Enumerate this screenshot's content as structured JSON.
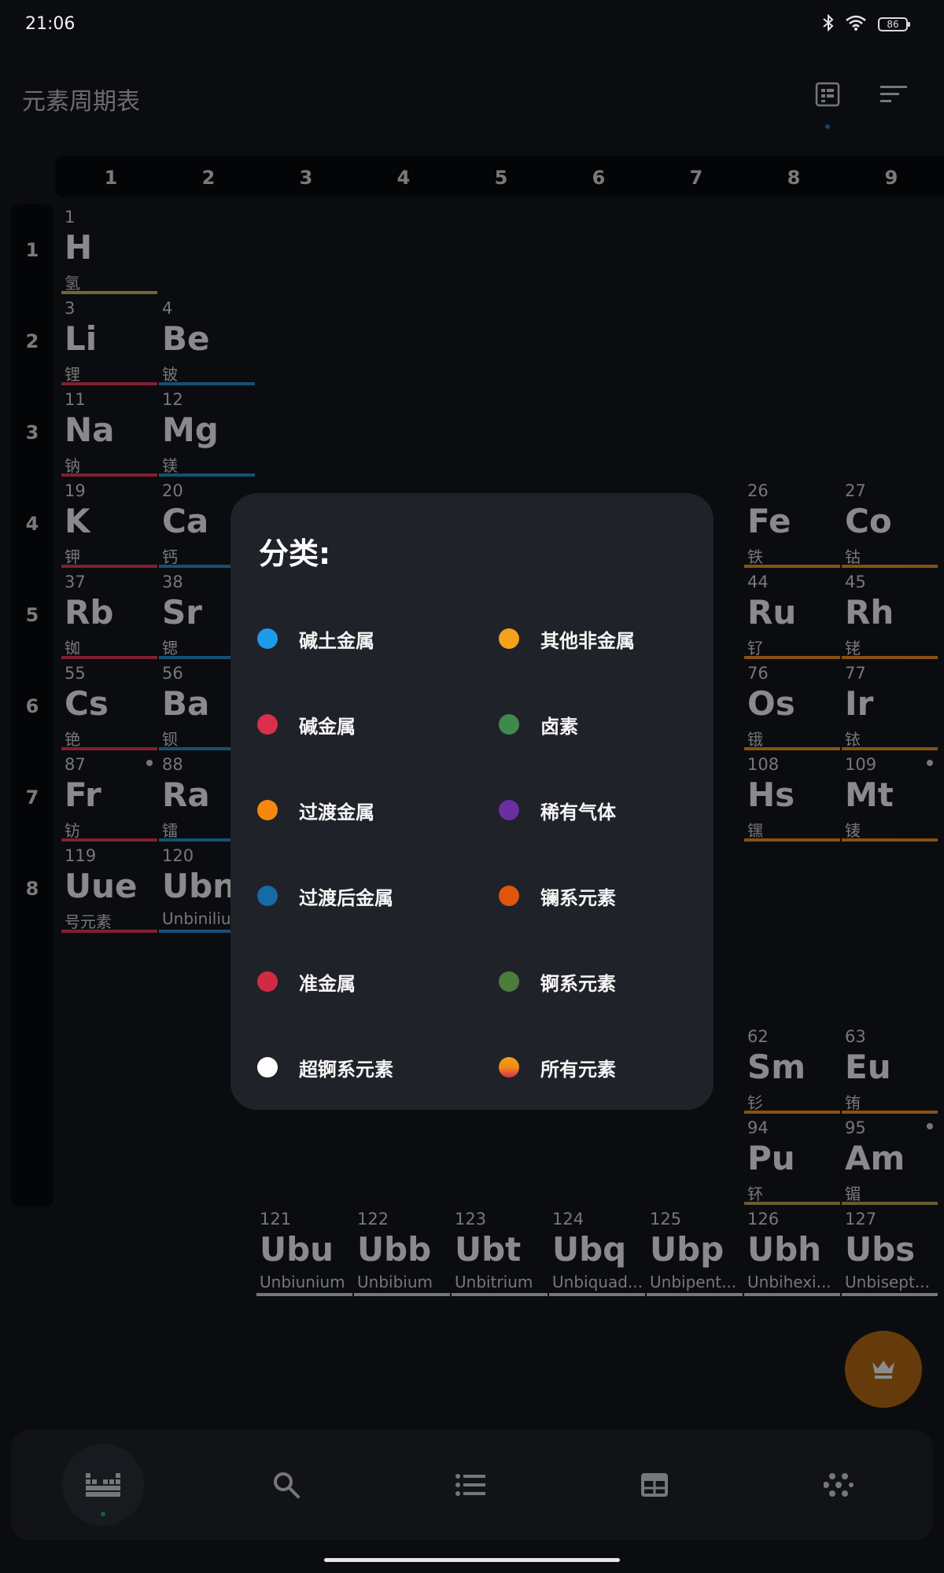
{
  "status_bar": {
    "time": "21:06",
    "battery": "86",
    "icons": [
      "bluetooth-icon",
      "wifi-icon",
      "battery-icon"
    ]
  },
  "app_bar": {
    "title": "元素周期表",
    "actions": [
      "layout-view-icon",
      "sort-icon"
    ]
  },
  "table": {
    "groups": [
      "1",
      "2",
      "3",
      "4",
      "5",
      "6",
      "7",
      "8",
      "9"
    ],
    "periods": [
      "1",
      "2",
      "3",
      "4",
      "5",
      "6",
      "7",
      "8"
    ],
    "cells": [
      {
        "num": "1",
        "sym": "H",
        "name": "氢",
        "cat": "hal"
      },
      {
        "num": "3",
        "sym": "Li",
        "name": "锂",
        "cat": "alk"
      },
      {
        "num": "4",
        "sym": "Be",
        "name": "铍",
        "cat": "ae"
      },
      {
        "num": "11",
        "sym": "Na",
        "name": "钠",
        "cat": "alk"
      },
      {
        "num": "12",
        "sym": "Mg",
        "name": "镁",
        "cat": "ae"
      },
      {
        "num": "19",
        "sym": "K",
        "name": "钾",
        "cat": "alk"
      },
      {
        "num": "20",
        "sym": "Ca",
        "name": "钙",
        "cat": "ae"
      },
      {
        "num": "26",
        "sym": "Fe",
        "name": "铁",
        "cat": "tm"
      },
      {
        "num": "27",
        "sym": "Co",
        "name": "钴",
        "cat": "tm"
      },
      {
        "num": "37",
        "sym": "Rb",
        "name": "铷",
        "cat": "alk"
      },
      {
        "num": "38",
        "sym": "Sr",
        "name": "锶",
        "cat": "ae"
      },
      {
        "num": "44",
        "sym": "Ru",
        "name": "钌",
        "cat": "tm"
      },
      {
        "num": "45",
        "sym": "Rh",
        "name": "铑",
        "cat": "tm"
      },
      {
        "num": "55",
        "sym": "Cs",
        "name": "铯",
        "cat": "alk"
      },
      {
        "num": "56",
        "sym": "Ba",
        "name": "钡",
        "cat": "ae"
      },
      {
        "num": "76",
        "sym": "Os",
        "name": "锇",
        "cat": "tm"
      },
      {
        "num": "77",
        "sym": "Ir",
        "name": "铱",
        "cat": "tm"
      },
      {
        "num": "87",
        "sym": "Fr",
        "name": "钫",
        "cat": "alk",
        "mark": true
      },
      {
        "num": "88",
        "sym": "Ra",
        "name": "镭",
        "cat": "ae"
      },
      {
        "num": "108",
        "sym": "Hs",
        "name": "𬭶",
        "cat": "tm"
      },
      {
        "num": "109",
        "sym": "Mt",
        "name": "鿏",
        "cat": "tm",
        "mark": true
      },
      {
        "num": "119",
        "sym": "Uue",
        "name": "号元素",
        "cat": "alk"
      },
      {
        "num": "120",
        "sym": "Ubn",
        "name": "Unbinilium",
        "cat": "ae"
      },
      {
        "num": "62",
        "sym": "Sm",
        "name": "钐",
        "cat": "ln"
      },
      {
        "num": "63",
        "sym": "Eu",
        "name": "铕",
        "cat": "ln"
      },
      {
        "num": "94",
        "sym": "Pu",
        "name": "钚",
        "cat": "ac"
      },
      {
        "num": "95",
        "sym": "Am",
        "name": "镅",
        "cat": "ac",
        "mark": true
      },
      {
        "num": "121",
        "sym": "Ubu",
        "name": "Unbiunium",
        "cat": "unk"
      },
      {
        "num": "122",
        "sym": "Ubb",
        "name": "Unbibium",
        "cat": "unk"
      },
      {
        "num": "123",
        "sym": "Ubt",
        "name": "Unbitrium",
        "cat": "unk"
      },
      {
        "num": "124",
        "sym": "Ubq",
        "name": "Unbiquad...",
        "cat": "unk"
      },
      {
        "num": "125",
        "sym": "Ubp",
        "name": "Unbipent...",
        "cat": "unk"
      },
      {
        "num": "126",
        "sym": "Ubh",
        "name": "Unbihexi...",
        "cat": "unk"
      },
      {
        "num": "127",
        "sym": "Ubs",
        "name": "Unbisept...",
        "cat": "unk"
      }
    ]
  },
  "dialog": {
    "title": "分类:",
    "legend": [
      {
        "label": "碱土金属",
        "color": "#1e9be8"
      },
      {
        "label": "其他非金属",
        "color": "#f4a11c"
      },
      {
        "label": "碱金属",
        "color": "#d8304c"
      },
      {
        "label": "卤素",
        "color": "#3f8a4b"
      },
      {
        "label": "过渡金属",
        "color": "#f7870f"
      },
      {
        "label": "稀有气体",
        "color": "#6a2fa0"
      },
      {
        "label": "过渡后金属",
        "color": "#166aa5"
      },
      {
        "label": "镧系元素",
        "color": "#e0550e"
      },
      {
        "label": "准金属",
        "color": "#d22a45"
      },
      {
        "label": "锕系元素",
        "color": "#4d7b3c"
      },
      {
        "label": "超锕系元素",
        "color": "#ffffff"
      },
      {
        "label": "所有元素",
        "color": "#f08a15"
      }
    ]
  },
  "fab": {
    "icon": "crown-icon"
  },
  "bottom_nav": {
    "items": [
      {
        "icon": "periodic-table-icon",
        "active": true
      },
      {
        "icon": "search-icon"
      },
      {
        "icon": "list-icon"
      },
      {
        "icon": "grid-table-icon"
      },
      {
        "icon": "dots-grid-icon"
      }
    ]
  }
}
